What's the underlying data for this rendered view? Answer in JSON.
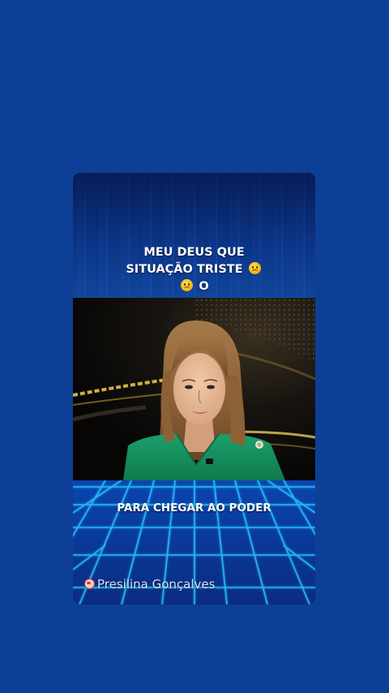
{
  "card": {
    "caption_top": {
      "line1": "MEU DEUS QUE",
      "line2": "SITUAÇÃO TRISTE",
      "line3_suffix": "O",
      "emoji": "sad-face-icon"
    },
    "caption_bottom": "PARA CHEGAR AO PODER",
    "watermark": {
      "icon": "face-icon",
      "text": "Presilina Gonçalves"
    }
  },
  "colors": {
    "background": "#0e3f96",
    "grid_line": "#27c4ff",
    "video_blouse": "#14915f"
  }
}
